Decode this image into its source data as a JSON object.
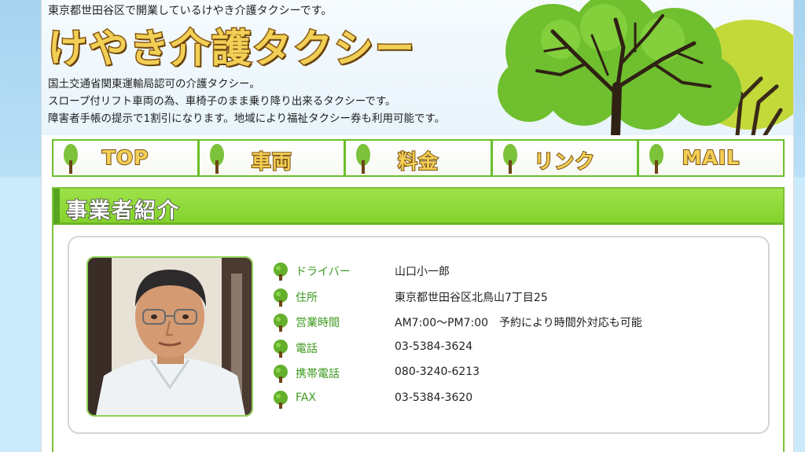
{
  "header": {
    "tagline": "東京都世田谷区で開業しているけやき介護タクシーです。",
    "logo_text": "けやき介護タクシー",
    "description": [
      "国土交通省関東運輸局認可の介護タクシー。",
      "スロープ付リフト車両の為、車椅子のまま乗り降り出来るタクシーです。",
      "障害者手帳の提示で1割引になります。地域により福祉タクシー券も利用可能です。"
    ]
  },
  "nav": [
    {
      "label": "TOP"
    },
    {
      "label": "車両"
    },
    {
      "label": "料金"
    },
    {
      "label": "リンク"
    },
    {
      "label": "MAIL"
    }
  ],
  "section": {
    "title": "事業者紹介"
  },
  "profile": {
    "rows": [
      {
        "label": "ドライバー",
        "value": "山口小一郎"
      },
      {
        "label": "住所",
        "value": "東京都世田谷区北鳥山7丁目25"
      },
      {
        "label": "営業時間",
        "value": "AM7:00～PM7:00　予約により時間外対応も可能"
      },
      {
        "label": "電話",
        "value": "03-5384-3624"
      },
      {
        "label": "携帯電話",
        "value": "080-3240-6213"
      },
      {
        "label": "FAX",
        "value": "03-5384-3620"
      }
    ]
  },
  "colors": {
    "accent_green": "#84d22c",
    "label_green": "#3d9a1f",
    "logo_gold": "#f2cf55",
    "logo_brown": "#8a5a14"
  },
  "icons": {
    "nav_icon": "tree-icon",
    "row_icon": "tree-icon"
  }
}
